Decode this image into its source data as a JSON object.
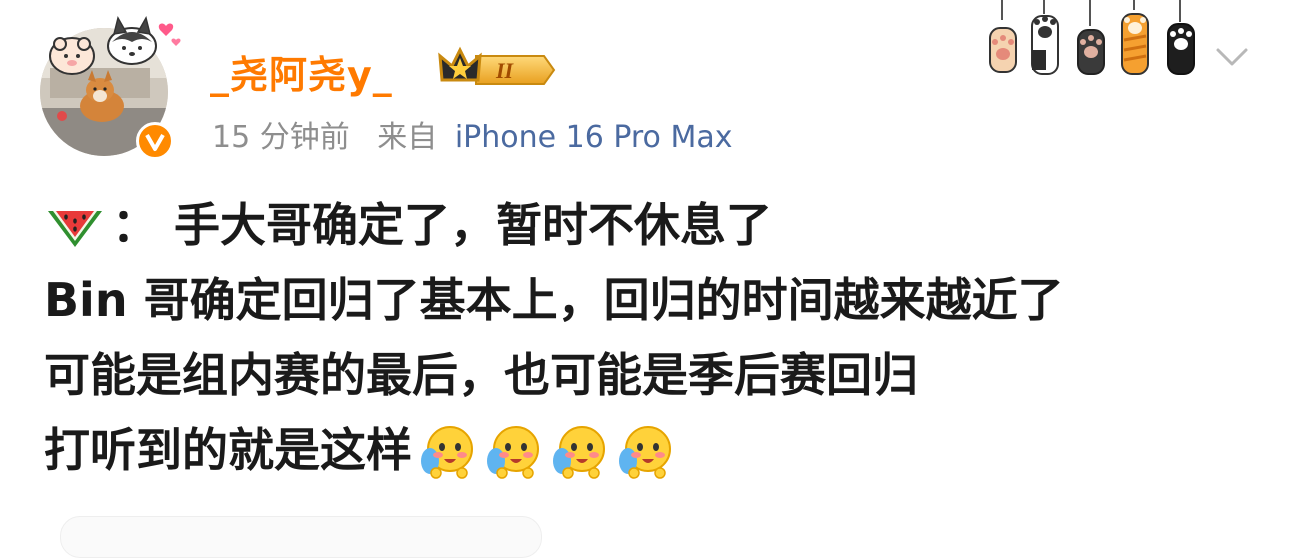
{
  "post": {
    "author": {
      "username": "_尧阿尧y_",
      "badge_level": "II",
      "verified": true
    },
    "meta": {
      "time": "15 分钟前",
      "from_label": "来自",
      "device": "iPhone 16 Pro Max"
    },
    "content": {
      "line1_text": "：  手大哥确定了，暂时不休息了",
      "line2_text": "Bin 哥确定回归了基本上，回归的时间越来越近了",
      "line3_text": "可能是组内赛的最后，也可能是季后赛回归",
      "line4_text": "打听到的就是这样"
    },
    "icons": {
      "line1_emoji": "watermelon-icon",
      "line4_emojis": [
        "blush-emoji-icon",
        "blush-emoji-icon",
        "blush-emoji-icon",
        "blush-emoji-icon"
      ],
      "decor": "cat-paws-decoration",
      "menu": "chevron-down-icon"
    },
    "colors": {
      "username": "#ff7a00",
      "device_link": "#4b6aa0",
      "meta": "#8e8e8e",
      "verified_badge": "#ff8a00"
    }
  }
}
